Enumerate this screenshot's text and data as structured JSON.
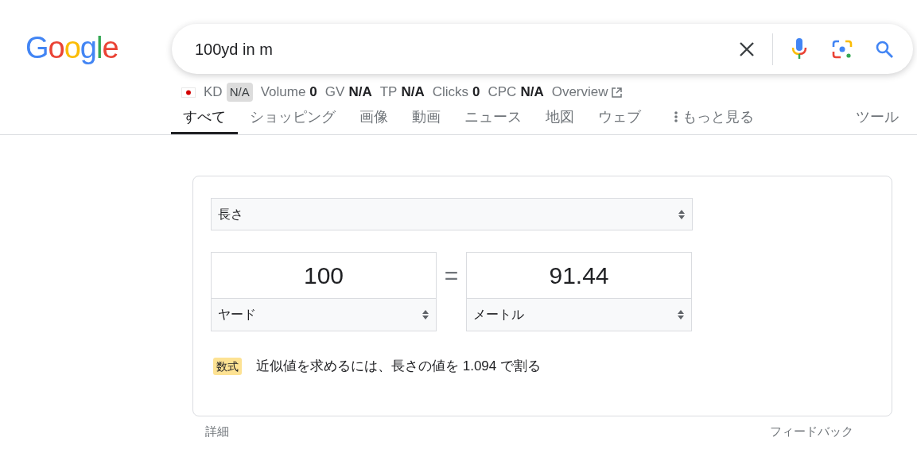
{
  "logo": "Google",
  "search": {
    "value": "100yd in m"
  },
  "metrics": [
    {
      "label": "KD",
      "value": "N/A",
      "kind": "badge"
    },
    {
      "label": "Volume",
      "value": "0",
      "kind": "bold"
    },
    {
      "label": "GV",
      "value": "N/A",
      "kind": "bold"
    },
    {
      "label": "TP",
      "value": "N/A",
      "kind": "bold"
    },
    {
      "label": "Clicks",
      "value": "0",
      "kind": "bold"
    },
    {
      "label": "CPC",
      "value": "N/A",
      "kind": "bold"
    }
  ],
  "overview_link": "Overview",
  "tabs": [
    {
      "label": "すべて",
      "selected": true,
      "kind": "tab"
    },
    {
      "label": "ショッピング",
      "selected": false,
      "kind": "tab"
    },
    {
      "label": "画像",
      "selected": false,
      "kind": "tab"
    },
    {
      "label": "動画",
      "selected": false,
      "kind": "tab"
    },
    {
      "label": "ニュース",
      "selected": false,
      "kind": "tab"
    },
    {
      "label": "地図",
      "selected": false,
      "kind": "tab"
    },
    {
      "label": "ウェブ",
      "selected": false,
      "kind": "tab"
    },
    {
      "label": "もっと見る",
      "selected": false,
      "kind": "more"
    }
  ],
  "tools": "ツール",
  "converter": {
    "category": "長さ",
    "from_value": "100",
    "from_unit": "ヤード",
    "equals": "=",
    "to_value": "91.44",
    "to_unit": "メートル",
    "formula_badge": "数式",
    "formula": "近似値を求めるには、長さの値を 1.094 で割る"
  },
  "footer": {
    "details": "詳細",
    "feedback": "フィードバック"
  }
}
